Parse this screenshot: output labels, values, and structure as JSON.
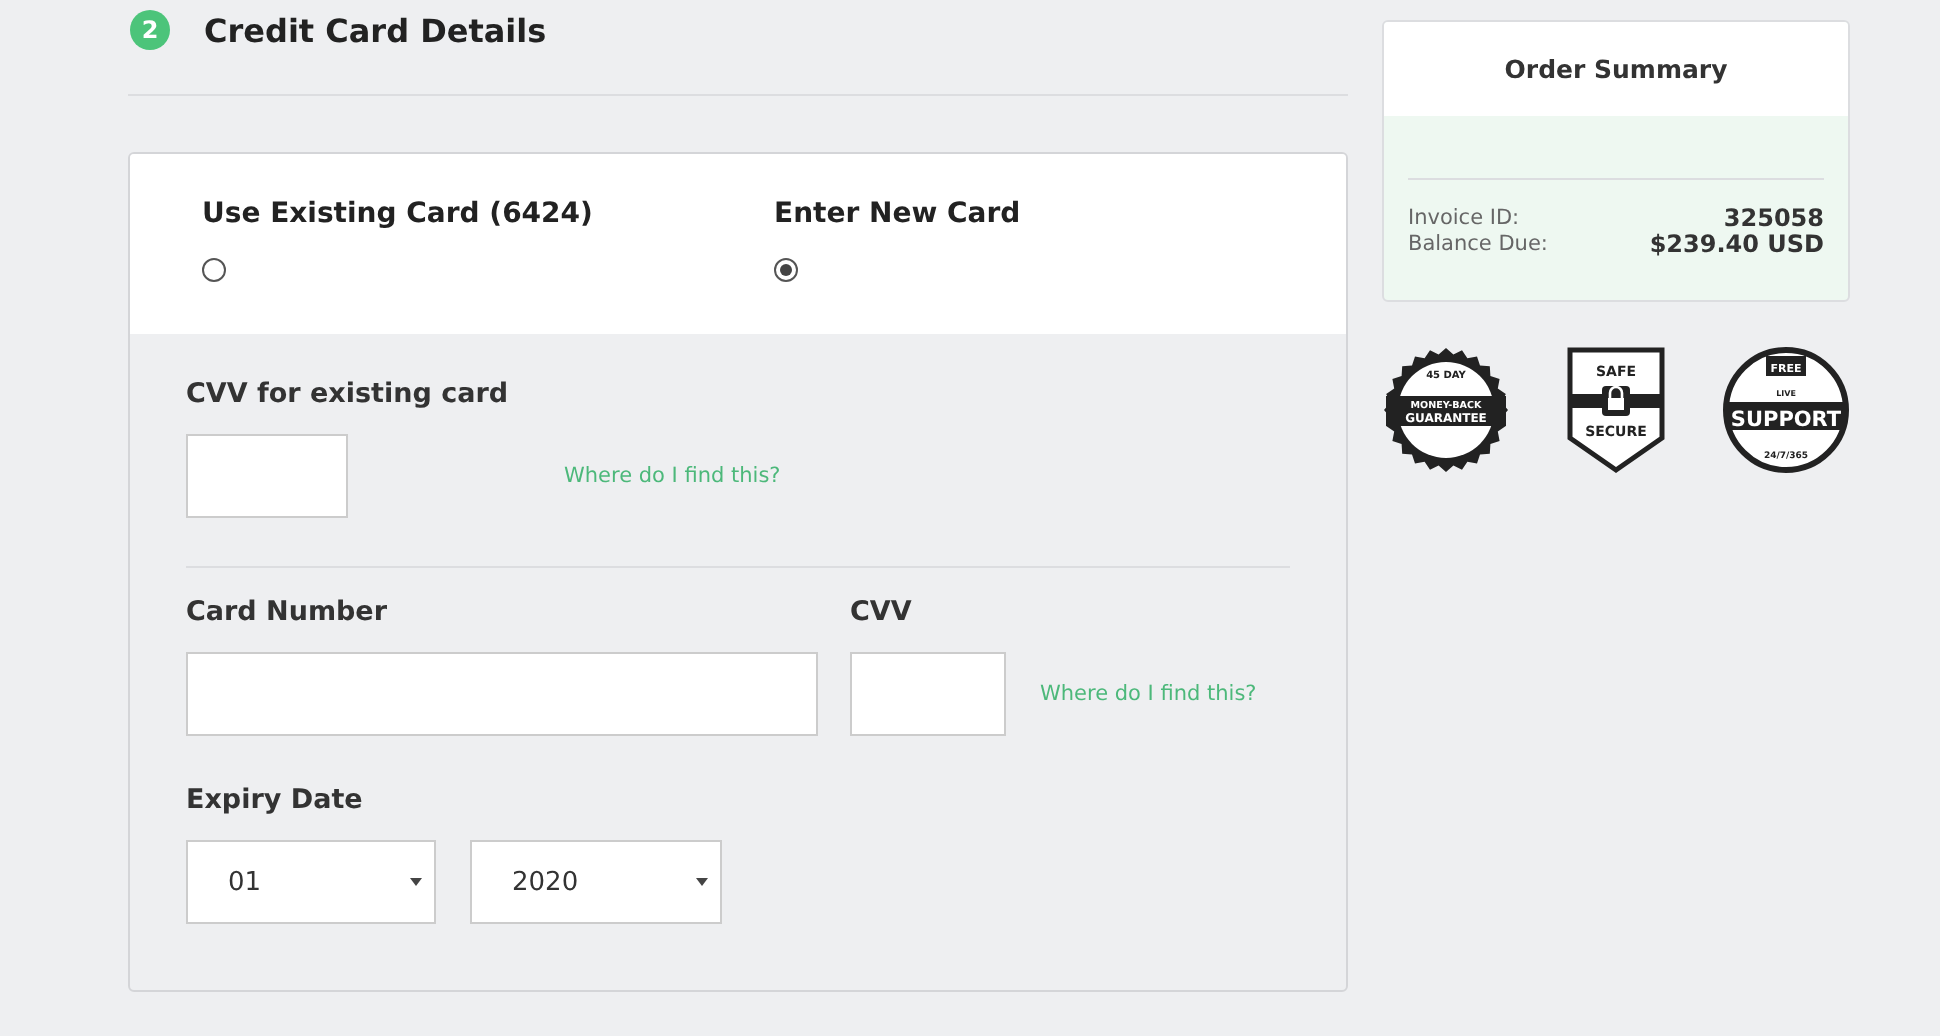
{
  "section": {
    "step": "2",
    "title": "Credit Card Details"
  },
  "options": [
    {
      "label": "Use Existing Card (6424)",
      "selected": false
    },
    {
      "label": "Enter New Card",
      "selected": true
    }
  ],
  "existing_card": {
    "cvv_label": "CVV for existing card",
    "help_link": "Where do I find this?"
  },
  "new_card": {
    "number_label": "Card Number",
    "cvv_label": "CVV",
    "help_link": "Where do I find this?",
    "expiry_label": "Expiry Date",
    "month": "01",
    "year": "2020"
  },
  "order_summary": {
    "title": "Order Summary",
    "rows": [
      {
        "label": "Invoice ID:",
        "value": "325058"
      },
      {
        "label": "Balance Due:",
        "value": "$239.40 USD"
      }
    ]
  },
  "badges": [
    {
      "kind": "guarantee",
      "texts": [
        "45 DAY",
        "MONEY-BACK",
        "GUARANTEE"
      ]
    },
    {
      "kind": "secure",
      "texts": [
        "SAFE",
        "SECURE"
      ]
    },
    {
      "kind": "support",
      "texts": [
        "FREE",
        "LIVE",
        "SUPPORT",
        "24/7/365"
      ]
    }
  ]
}
